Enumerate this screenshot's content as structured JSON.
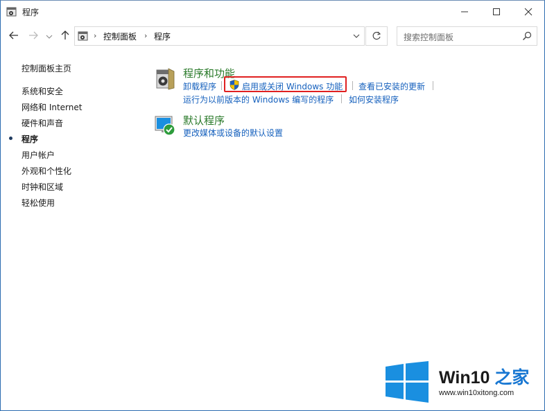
{
  "window": {
    "title": "程序"
  },
  "nav": {
    "breadcrumb": [
      "控制面板",
      "程序"
    ],
    "search_placeholder": "搜索控制面板"
  },
  "sidebar": {
    "home": "控制面板主页",
    "items": [
      {
        "label": "系统和安全",
        "current": false
      },
      {
        "label": "网络和 Internet",
        "current": false
      },
      {
        "label": "硬件和声音",
        "current": false
      },
      {
        "label": "程序",
        "current": true
      },
      {
        "label": "用户帐户",
        "current": false
      },
      {
        "label": "外观和个性化",
        "current": false
      },
      {
        "label": "时钟和区域",
        "current": false
      },
      {
        "label": "轻松使用",
        "current": false
      }
    ]
  },
  "main": {
    "programs_features": {
      "title": "程序和功能",
      "links": [
        "卸载程序",
        "启用或关闭 Windows 功能",
        "查看已安装的更新",
        "运行为以前版本的 Windows 编写的程序",
        "如何安装程序"
      ]
    },
    "default_programs": {
      "title": "默认程序",
      "links": [
        "更改媒体或设备的默认设置"
      ]
    }
  },
  "watermark": {
    "brand": "Win10",
    "brand_suffix": "之家",
    "url": "www.win10xitong.com"
  },
  "colors": {
    "link": "#1560bd",
    "category_title": "#2a7a2a",
    "highlight": "#e02020",
    "win_blue": "#1a8fe0"
  }
}
